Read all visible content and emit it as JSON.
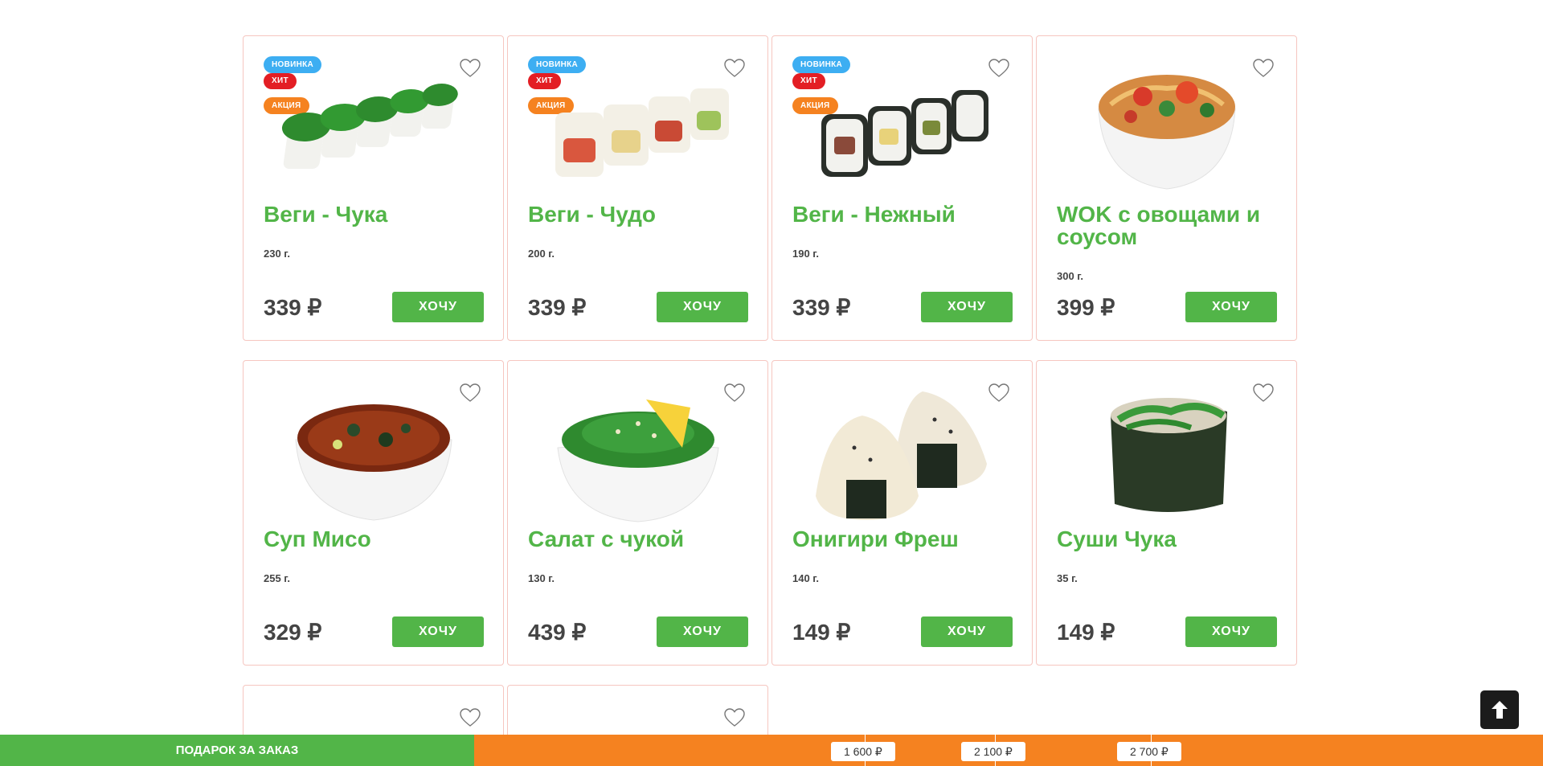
{
  "badges": {
    "new": "НОВИНКА",
    "hit": "ХИТ",
    "promo": "АКЦИЯ"
  },
  "button_label": "ХОЧУ",
  "products": [
    {
      "name": "Веги - Чука",
      "weight": "230 г.",
      "price": "339 ₽"
    },
    {
      "name": "Веги - Чудо",
      "weight": "200 г.",
      "price": "339 ₽"
    },
    {
      "name": "Веги - Нежный",
      "weight": "190 г.",
      "price": "339 ₽"
    },
    {
      "name": "WOK с овощами и соусом",
      "weight": "300 г.",
      "price": "399 ₽"
    },
    {
      "name": "Суп Мисо",
      "weight": "255 г.",
      "price": "329 ₽"
    },
    {
      "name": "Салат с чукой",
      "weight": "130 г.",
      "price": "439 ₽"
    },
    {
      "name": "Онигири Фреш",
      "weight": "140 г.",
      "price": "149 ₽"
    },
    {
      "name": "Суши Чука",
      "weight": "35 г.",
      "price": "149 ₽"
    }
  ],
  "gift_bar": {
    "label": "ПОДАРОК ЗА ЗАКАЗ",
    "tiers": [
      "1 600 ₽",
      "2 100 ₽",
      "2 700 ₽"
    ]
  },
  "colors": {
    "accent_green": "#52b548",
    "accent_orange": "#f58220",
    "badge_blue": "#3daef2",
    "badge_red": "#e31e24"
  }
}
